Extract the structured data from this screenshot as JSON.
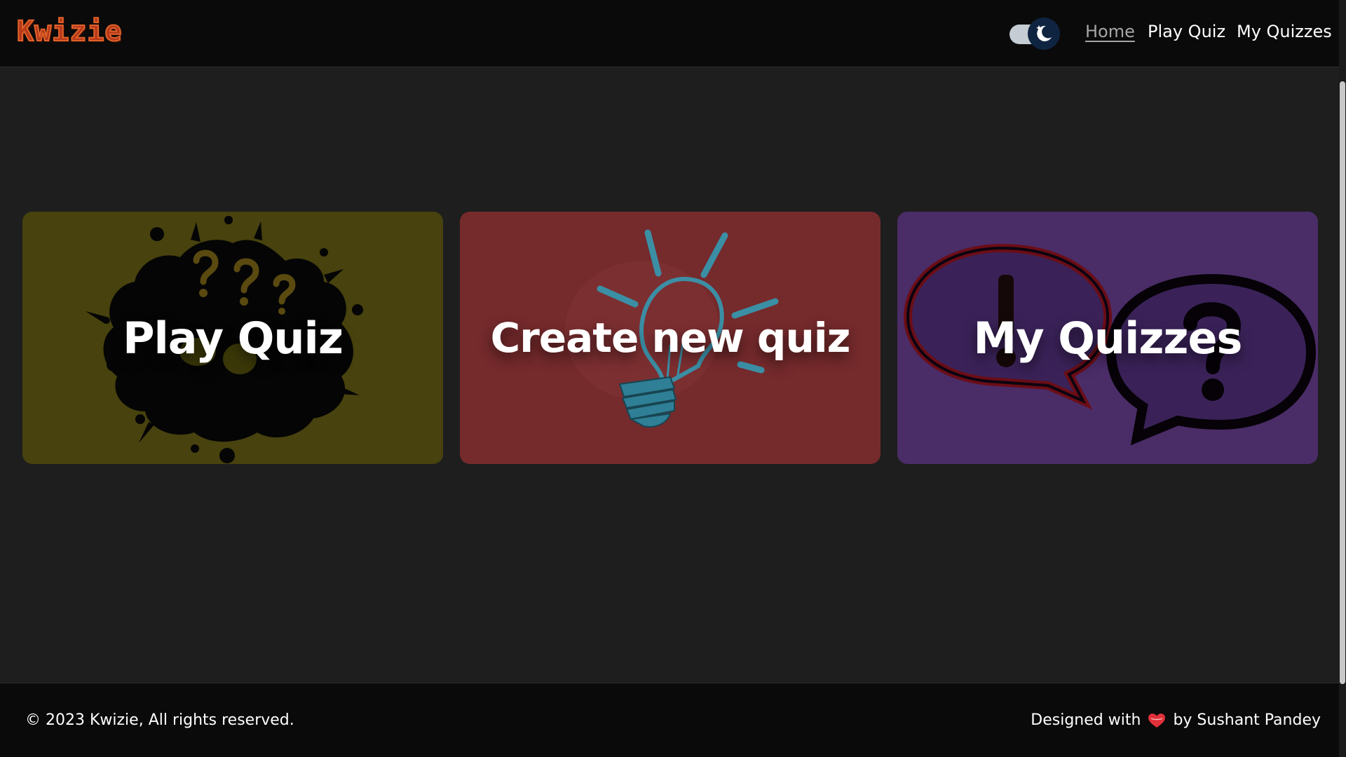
{
  "brand": {
    "name": "Kwizie",
    "accent": "#b5391a"
  },
  "theme_toggle": {
    "icon": "moon-icon",
    "mode": "dark"
  },
  "nav": {
    "items": [
      {
        "label": "Home",
        "active": true
      },
      {
        "label": "Play Quiz",
        "active": false
      },
      {
        "label": "My Quizzes",
        "active": false
      }
    ]
  },
  "cards": [
    {
      "title": "Play Quiz",
      "icon": "question-splash-icon",
      "color": "#47420e"
    },
    {
      "title": "Create new quiz",
      "icon": "lightbulb-icon",
      "color": "#752a2c"
    },
    {
      "title": "My Quizzes",
      "icon": "speech-bubbles-icon",
      "color": "#4a2c67"
    }
  ],
  "footer": {
    "copyright": "© 2023 Kwizie, All rights reserved.",
    "credit_prefix": "Designed with",
    "credit_icon": "heart-icon",
    "credit_suffix": "by Sushant Pandey"
  },
  "colors": {
    "background": "#1e1e1e",
    "header": "#0a0a0a",
    "heart": "#e0303a"
  }
}
